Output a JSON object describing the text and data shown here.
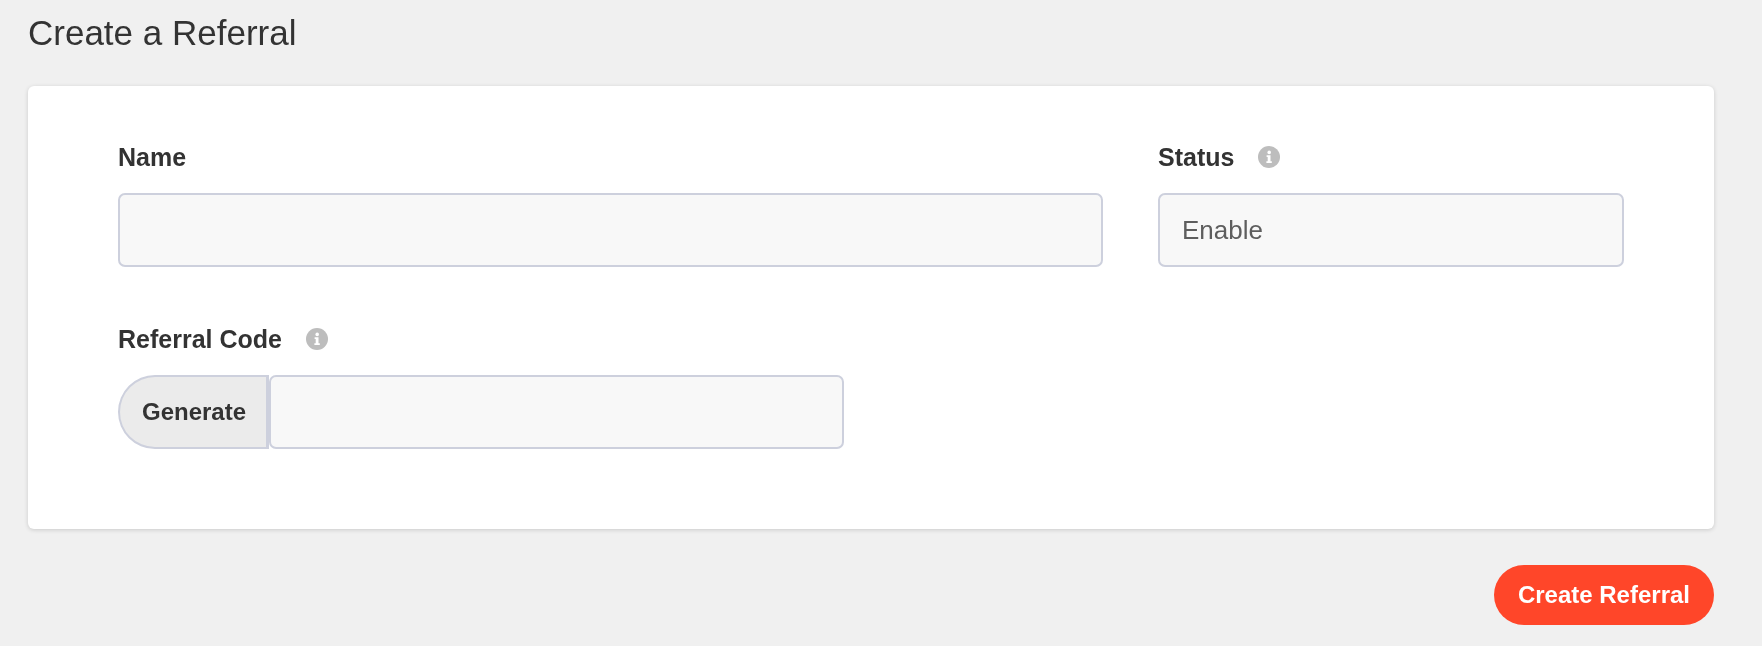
{
  "page": {
    "title": "Create a Referral"
  },
  "form": {
    "fields": [
      {
        "kind": "text",
        "label": "Name",
        "info_icon": false
      },
      {
        "kind": "select",
        "label": "Status",
        "info_icon": true,
        "value": "Enable"
      },
      {
        "kind": "generate",
        "label": "Referral Code",
        "info_icon": true,
        "button": "Generate"
      }
    ]
  },
  "actions": {
    "submit": "Create Referral"
  }
}
